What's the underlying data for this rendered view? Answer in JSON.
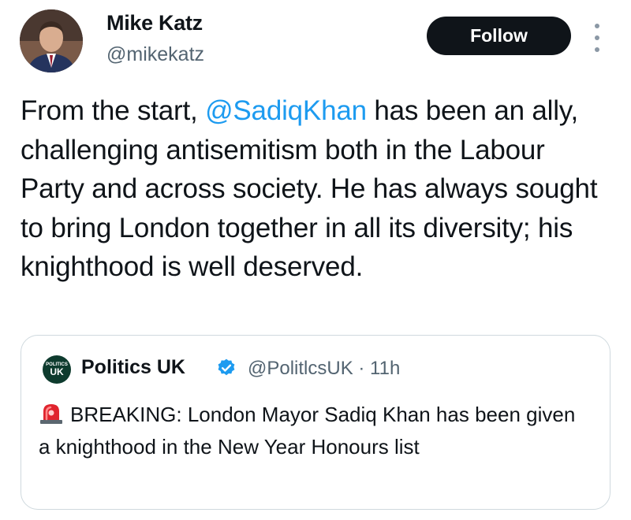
{
  "author": {
    "name": "Mike Katz",
    "handle": "@mikekatz",
    "avatar_icon": "profile-photo"
  },
  "follow_button": {
    "label": "Follow"
  },
  "more_menu": {
    "icon": "more-vertical-icon"
  },
  "tweet": {
    "text_before": "From the start, ",
    "mention": "@SadiqKhan",
    "text_after": " has been an ally, challenging antisemitism both in the Labour Party and across society. He has always sought to bring London together in all its diversity; his knighthood is well deserved."
  },
  "quoted_tweet": {
    "avatar_text_small": "POLITICS",
    "avatar_text_big": "UK",
    "name": "Politics UK",
    "verified_icon": "verified-badge-icon",
    "handle_time": "@PolitlcsUK · 11h",
    "siren_icon": "rotating-light-emoji",
    "text": "BREAKING: London Mayor Sadiq Khan has been given a knighthood in the New Year Honours list"
  },
  "colors": {
    "mention": "#1d9bf0",
    "follow_bg": "#0f1419",
    "secondary_text": "#536471",
    "card_border": "#cfd9de",
    "verified": "#1d9bf0"
  }
}
